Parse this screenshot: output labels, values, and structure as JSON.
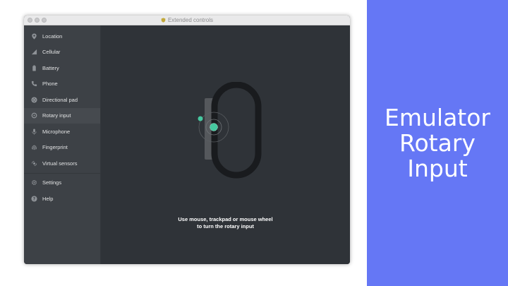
{
  "window": {
    "title": "Extended controls",
    "title_icon": "shield-icon"
  },
  "sidebar": {
    "items": [
      {
        "label": "Location",
        "icon": "location-pin-icon"
      },
      {
        "label": "Cellular",
        "icon": "cellular-signal-icon"
      },
      {
        "label": "Battery",
        "icon": "battery-icon"
      },
      {
        "label": "Phone",
        "icon": "phone-icon"
      },
      {
        "label": "Directional pad",
        "icon": "dpad-icon"
      },
      {
        "label": "Rotary input",
        "icon": "rotary-icon",
        "active": true
      },
      {
        "label": "Microphone",
        "icon": "microphone-icon"
      },
      {
        "label": "Fingerprint",
        "icon": "fingerprint-icon"
      },
      {
        "label": "Virtual sensors",
        "icon": "sensors-icon"
      },
      {
        "label": "Settings",
        "icon": "gear-icon"
      },
      {
        "label": "Help",
        "icon": "help-icon"
      }
    ]
  },
  "main": {
    "instruction_line1": "Use mouse, trackpad or mouse wheel",
    "instruction_line2": "to turn the rotary input"
  },
  "banner": {
    "line1": "Emulator",
    "line2": "Rotary",
    "line3": "Input",
    "color": "#6577f5"
  },
  "colors": {
    "accent": "#46c8a0",
    "sidebar_bg": "#3d4146",
    "main_bg": "#2f3338"
  }
}
